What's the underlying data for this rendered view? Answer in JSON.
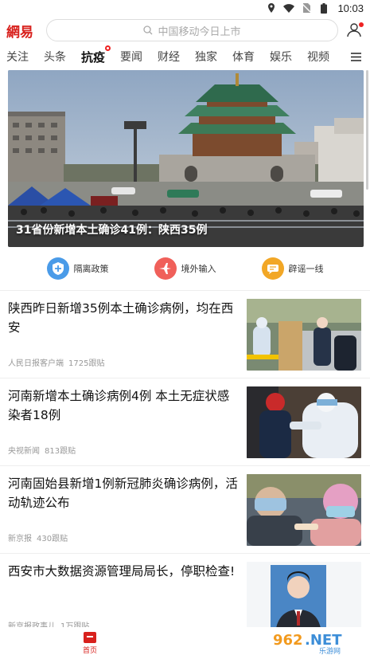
{
  "status_bar": {
    "time": "10:03"
  },
  "header": {
    "logo": "網易",
    "search_placeholder": "中国移动今日上市"
  },
  "tabs": [
    {
      "label": "关注",
      "active": false
    },
    {
      "label": "头条",
      "active": false
    },
    {
      "label": "抗疫",
      "active": true
    },
    {
      "label": "要闻",
      "active": false
    },
    {
      "label": "财经",
      "active": false
    },
    {
      "label": "独家",
      "active": false
    },
    {
      "label": "体育",
      "active": false
    },
    {
      "label": "娱乐",
      "active": false
    },
    {
      "label": "视频",
      "active": false
    }
  ],
  "hero": {
    "caption": "31省份新增本土确诊41例：陕西35例"
  },
  "quick_links": [
    {
      "label": "隔离政策",
      "color": "#4a9be8",
      "icon": "shield-plus-icon"
    },
    {
      "label": "境外输入",
      "color": "#f0605a",
      "icon": "airplane-icon"
    },
    {
      "label": "辟谣一线",
      "color": "#f2a726",
      "icon": "megaphone-icon"
    }
  ],
  "news": [
    {
      "title": "陕西昨日新增35例本土确诊病例，均在西安",
      "source": "人民日报客户端",
      "comments": "1725跟贴"
    },
    {
      "title": "河南新增本土确诊病例4例 本土无症状感染者18例",
      "source": "央视新闻",
      "comments": "813跟贴"
    },
    {
      "title": "河南固始县新增1例新冠肺炎确诊病例，活动轨迹公布",
      "source": "新京报",
      "comments": "430跟贴"
    },
    {
      "title": "西安市大数据资源管理局局长，停职检查!",
      "source": "新京报政事儿",
      "comments": "1万跟贴"
    }
  ],
  "bottom_nav": {
    "home_label": "首页"
  },
  "watermark": {
    "text": "962.NET",
    "sub": "乐游网"
  }
}
